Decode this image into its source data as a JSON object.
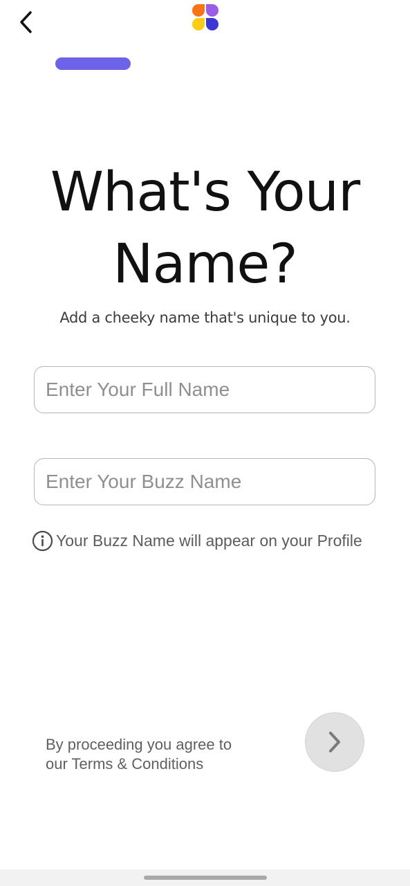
{
  "header": {
    "back_icon": "chevron-left-icon",
    "logo_icon": "four-petal-app-logo",
    "logo_colors": [
      "#f97316",
      "#9b5de5",
      "#facc15",
      "#3b36d6"
    ]
  },
  "progress": {
    "value": 0.2,
    "color": "#6c63e8"
  },
  "title": {
    "line1": "What's Your",
    "line2": "Name?"
  },
  "subtitle": "Add a cheeky name that's unique to you.",
  "form": {
    "full_name": {
      "placeholder": "Enter Your Full Name",
      "value": ""
    },
    "buzz_name": {
      "placeholder": "Enter Your Buzz Name",
      "value": ""
    },
    "hint_icon": "info-icon",
    "hint_text": "Your Buzz Name will appear on your Profile"
  },
  "footer": {
    "terms_line1": "By proceeding you agree to",
    "terms_line2": "our Terms & Conditions",
    "next_icon": "chevron-right-icon",
    "next_enabled": false
  }
}
